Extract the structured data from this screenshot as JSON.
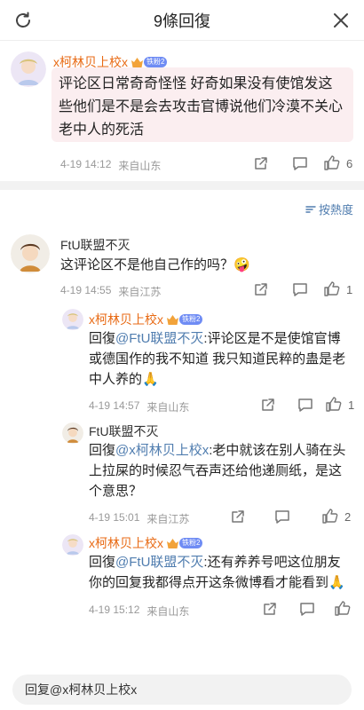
{
  "header": {
    "title": "9條回復"
  },
  "main_comment": {
    "user": "x柯林贝上校x",
    "badge_level": "铁粉2",
    "text": "评论区日常奇奇怪怪 好奇如果没有使馆发这些他们是不是会去攻击官博说他们冷漠不关心老中人的死活",
    "time": "4-19 14:12",
    "location": "来自山东",
    "likes": "6"
  },
  "sort": {
    "label": "按熱度"
  },
  "comments": [
    {
      "user": "FtU联盟不灭",
      "text": "这评论区不是他自己作的吗？",
      "emoji": "🤪",
      "time": "4-19 14:55",
      "location": "来自江苏",
      "likes": "1"
    },
    {
      "user": "x柯林贝上校x",
      "badge_level": "铁粉2",
      "prefix": "回復",
      "mention": "@FtU联盟不灭",
      "text": ":评论区是不是使馆官博或德国作的我不知道 我只知道民粹的蛊是老中人养的🙏",
      "time": "4-19 14:57",
      "location": "来自山东",
      "likes": "1"
    },
    {
      "user": "FtU联盟不灭",
      "prefix": "回復",
      "mention": "@x柯林贝上校x",
      "text": ":老中就该在别人骑在头上拉屎的时候忍气吞声还给他递厕纸，是这个意思？",
      "time": "4-19 15:01",
      "location": "来自江苏",
      "likes": "2"
    },
    {
      "user": "x柯林贝上校x",
      "badge_level": "铁粉2",
      "prefix": "回復",
      "mention": "@FtU联盟不灭",
      "text": ":还有养养号吧这位朋友你的回复我都得点开这条微博看才能看到🙏",
      "time": "4-19 15:12",
      "location": "来自山东",
      "likes": ""
    }
  ],
  "reply_bar": {
    "placeholder": "回复@x柯林贝上校x"
  },
  "colors": {
    "accent_name": "#e86a14",
    "link": "#507daf",
    "bubble": "#fbeef0"
  }
}
